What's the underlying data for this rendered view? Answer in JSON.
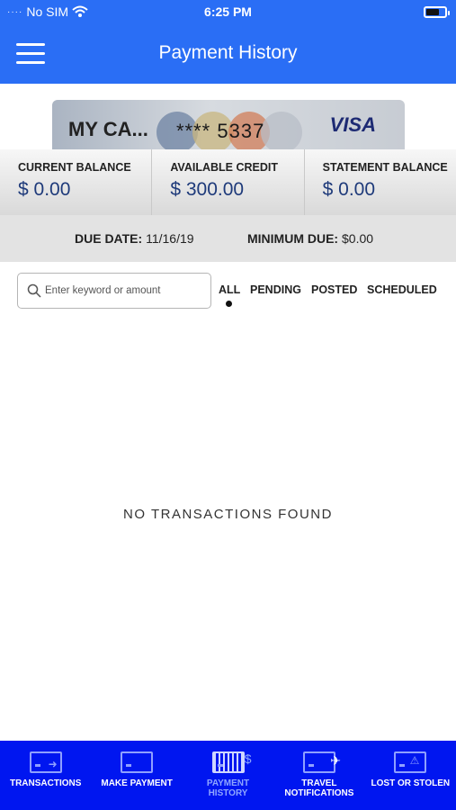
{
  "status": {
    "carrier": "No SIM",
    "time": "6:25 PM",
    "battery_level": 0.65
  },
  "header": {
    "title": "Payment History"
  },
  "card": {
    "name": "MY CA...",
    "number": "**** 5337",
    "brand": "VISA"
  },
  "balances": [
    {
      "label": "CURRENT BALANCE",
      "value": "$ 0.00"
    },
    {
      "label": "AVAILABLE CREDIT",
      "value": "$ 300.00"
    },
    {
      "label": "STATEMENT BALANCE",
      "value": "$ 0.00"
    }
  ],
  "due": {
    "date_label": "DUE DATE:",
    "date_value": "11/16/19",
    "min_label": "MINIMUM DUE:",
    "min_value": "$0.00"
  },
  "search": {
    "placeholder": "Enter keyword or amount",
    "value": ""
  },
  "filters": {
    "items": [
      "ALL",
      "PENDING",
      "POSTED",
      "SCHEDULED"
    ],
    "selected": "ALL"
  },
  "empty_message": "NO TRANSACTIONS FOUND",
  "nav": {
    "items": [
      {
        "label": "TRANSACTIONS",
        "icon": "card-arrow-icon"
      },
      {
        "label": "MAKE PAYMENT",
        "icon": "card-icon"
      },
      {
        "label": "PAYMENT HISTORY",
        "icon": "calendar-dollar-icon",
        "active": true
      },
      {
        "label": "TRAVEL NOTIFICATIONS",
        "icon": "card-plane-icon"
      },
      {
        "label": "LOST OR STOLEN",
        "icon": "card-warning-icon"
      }
    ]
  },
  "colors": {
    "primary": "#2a6ef5",
    "nav_bg": "#0016f0",
    "active_nav": "#8fa6ff"
  }
}
